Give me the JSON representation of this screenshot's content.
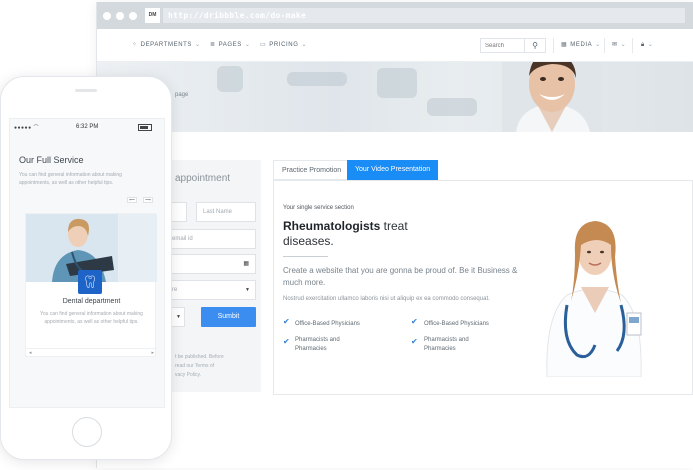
{
  "browser": {
    "logo": "DM",
    "url": "http://dribbble.com/do-make"
  },
  "nav": {
    "departments": "DEPARTMENTS",
    "pages": "PAGES",
    "pricing": "PRICING",
    "search_placeholder": "Search",
    "media": "MEDIA"
  },
  "hero": {
    "breadcrumb_fragment": "page"
  },
  "appointment": {
    "title_fragment": "appointment",
    "last_name_placeholder": "Last Name",
    "email_placeholder": "email id",
    "select_fragment": "re",
    "submit_label": "Sumbit",
    "note_line_1": "t be published. Before",
    "note_line_2": "read our Terms of",
    "note_line_3": "vacy Policy."
  },
  "tabs": {
    "tab_1": "Practice Promotion",
    "tab_2": "Your Video Presentation"
  },
  "content": {
    "eyebrow": "Your single service section",
    "heading_bold": "Rheumatologists",
    "heading_rest": " treat diseases.",
    "lead": "Create a website that you are gonna be proud of. Be it Business & much more.",
    "small": "Nostrud exercitation ullamco laboris nisi ut aliquip ex ea commodo consequat.",
    "features": [
      "Office-Based Physicians",
      "Office-Based Physicians",
      "Pharmacists and Pharmacies",
      "Pharmacists and Pharmacies"
    ]
  },
  "phone": {
    "time": "6:32 PM",
    "title": "Our Full Service",
    "desc": "You can find general information about making appointments, as well as other helpful tips.",
    "card_title": "Dental department",
    "card_desc": "You can find general information about making appointments, as well as other helpful tips."
  },
  "colors": {
    "accent": "#1a8cf5",
    "submit": "#3b8eef",
    "tooth_badge": "#1e63c7"
  }
}
